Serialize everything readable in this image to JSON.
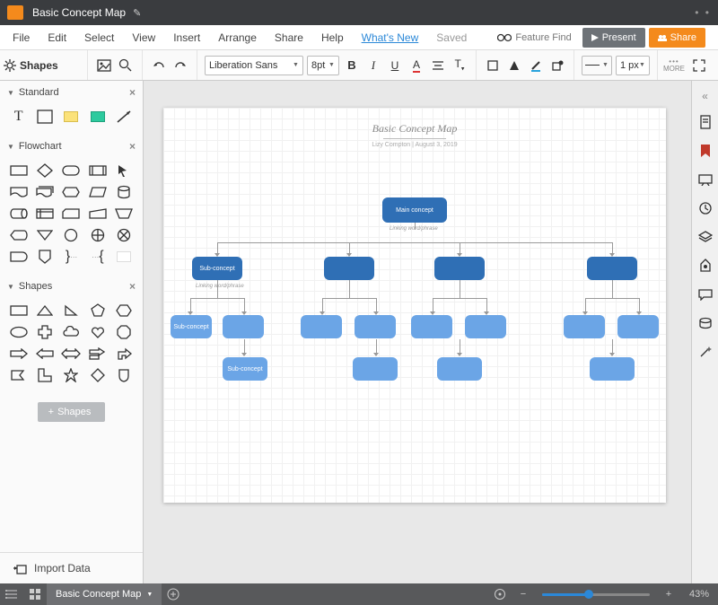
{
  "header": {
    "doc_title": "Basic Concept Map"
  },
  "menubar": {
    "items": [
      "File",
      "Edit",
      "Select",
      "View",
      "Insert",
      "Arrange",
      "Share",
      "Help",
      "What's New"
    ],
    "saved": "Saved",
    "feature_find": "Feature Find",
    "present": "Present",
    "share": "Share"
  },
  "toolbar": {
    "shapes_title": "Shapes",
    "font": "Liberation Sans",
    "font_size": "8pt",
    "line_width": "1 px",
    "more": "MORE"
  },
  "panel": {
    "cat1": "Standard",
    "cat2": "Flowchart",
    "cat3": "Shapes",
    "add_shapes": "Shapes",
    "import": "Import Data"
  },
  "canvas": {
    "title": "Basic Concept Map",
    "sub": "Lizy Compton  |  August 3, 2019",
    "main_label": "Main concept",
    "link1": "Linking word/phrase",
    "sub_label": "Sub-concept",
    "link2": "Linking word/phrase",
    "sub3": "Sub-concept",
    "sub4": "Sub-concept"
  },
  "statusbar": {
    "tab": "Basic Concept Map",
    "zoom": "43%",
    "zoom_pct": 43
  }
}
